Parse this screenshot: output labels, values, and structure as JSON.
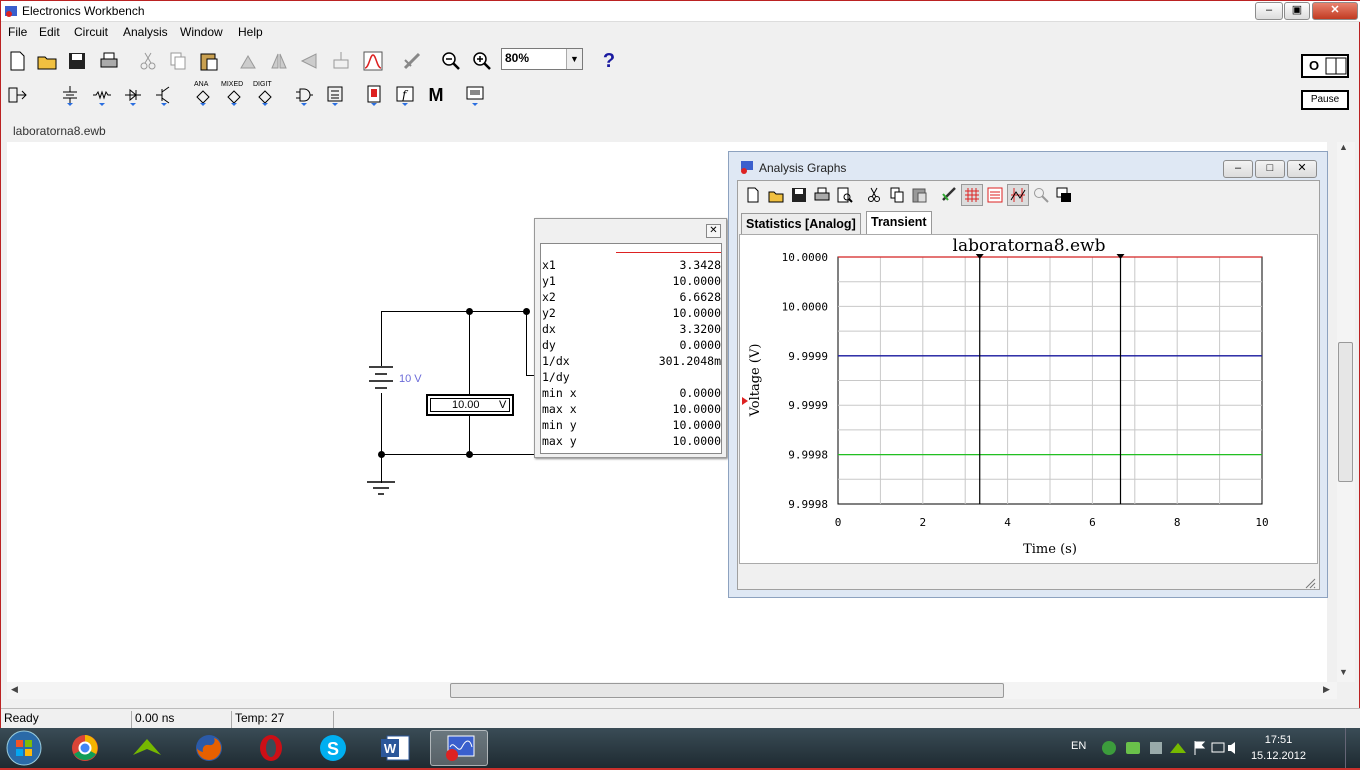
{
  "window": {
    "title": "Electronics Workbench"
  },
  "menu": [
    "File",
    "Edit",
    "Circuit",
    "Analysis",
    "Window",
    "Help"
  ],
  "toolbar": {
    "zoom": "80%",
    "help": "?"
  },
  "right_panel": {
    "power": "O",
    "pause": "Pause"
  },
  "parts_bin": {
    "ana": "ANA",
    "mixed": "MIXED",
    "digit": "DIGIT",
    "misc": "M"
  },
  "document": {
    "tab": "laboratorna8.ewb"
  },
  "circuit": {
    "battery_label": "10 V",
    "voltmeter_value": "10.00",
    "voltmeter_unit": "V"
  },
  "readout": {
    "rows": [
      {
        "key": "x1",
        "value": "3.3428"
      },
      {
        "key": "y1",
        "value": "10.0000"
      },
      {
        "key": "x2",
        "value": "6.6628"
      },
      {
        "key": "y2",
        "value": "10.0000"
      },
      {
        "key": "dx",
        "value": "3.3200"
      },
      {
        "key": "dy",
        "value": "0.0000"
      },
      {
        "key": "1/dx",
        "value": "301.2048m"
      },
      {
        "key": "1/dy",
        "value": ""
      },
      {
        "key": "min x",
        "value": "0.0000"
      },
      {
        "key": "max x",
        "value": "10.0000"
      },
      {
        "key": "min y",
        "value": "10.0000"
      },
      {
        "key": "max y",
        "value": "10.0000"
      }
    ]
  },
  "analysis_graphs": {
    "title": "Analysis Graphs",
    "tabs": [
      "Statistics [Analog]",
      "Transient"
    ],
    "active_tab": "Transient"
  },
  "chart_data": {
    "type": "line",
    "title": "laboratorna8.ewb",
    "xlabel": "Time (s)",
    "ylabel": "Voltage (V)",
    "xlim": [
      0,
      10
    ],
    "x_ticks": [
      "0",
      "2",
      "4",
      "6",
      "8",
      "10"
    ],
    "y_ticks": [
      "10.0000",
      "10.0000",
      "9.9999",
      "9.9999",
      "9.9998",
      "9.9998"
    ],
    "grid": true,
    "series": [
      {
        "color": "#d42020",
        "level": 0.0
      },
      {
        "color": "#1a1aa0",
        "level": 0.4
      },
      {
        "color": "#22c022",
        "level": 0.8
      }
    ],
    "cursors": [
      3.3428,
      6.6628
    ]
  },
  "status": {
    "ready": "Ready",
    "time": "0.00 ns",
    "temp": "Temp:  27"
  },
  "taskbar": {
    "lang": "EN",
    "time": "17:51",
    "date": "15.12.2012"
  }
}
